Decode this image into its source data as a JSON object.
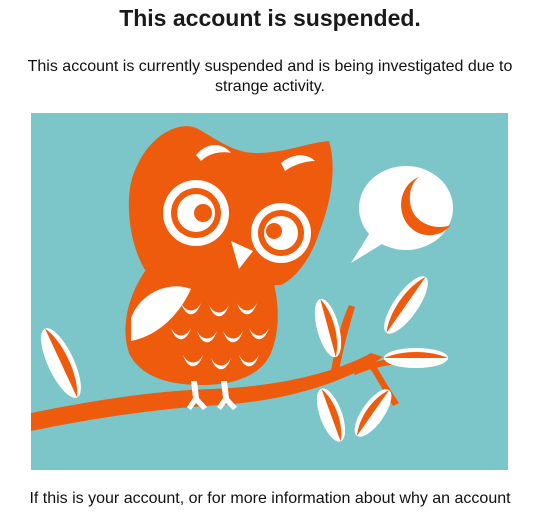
{
  "page": {
    "title": "This account is suspended.",
    "intro_line1": "This account is currently suspended and is being investigated due to",
    "intro_line2": "strange activity.",
    "footer_line": "If this is your account, or for more information about why an account"
  },
  "illustration": {
    "icon": "owl-on-branch-illustration",
    "colors": {
      "background": "#7cc6c9",
      "accent": "#ef5b0c",
      "white": "#ffffff"
    }
  }
}
